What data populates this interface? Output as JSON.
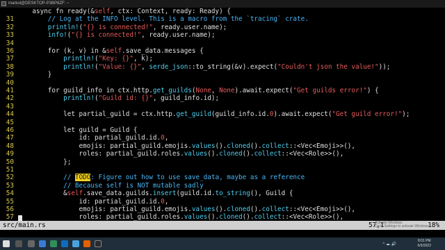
{
  "window": {
    "title": "markol@DESKTOP-P3BP8ZF: ~"
  },
  "code_lines": [
    {
      "n": "",
      "parts": [
        [
          "k",
          "    async fn ready(&"
        ],
        [
          "s",
          "self"
        ],
        [
          "k",
          ", ctx: Context, ready: Ready) {"
        ]
      ]
    },
    {
      "n": "31",
      "parts": [
        [
          "c",
          "        // Log at the INFO level. This is a macro from the `tracing` crate."
        ]
      ]
    },
    {
      "n": "32",
      "parts": [
        [
          "m",
          "        println!"
        ],
        [
          "k",
          "("
        ],
        [
          "s",
          "\"{} is connected!\""
        ],
        [
          "k",
          ", ready.user.name);"
        ]
      ]
    },
    {
      "n": "33",
      "parts": [
        [
          "m",
          "        info!"
        ],
        [
          "k",
          "("
        ],
        [
          "s",
          "\"{} is connected!\""
        ],
        [
          "k",
          ", ready.user.name);"
        ]
      ]
    },
    {
      "n": "34",
      "parts": []
    },
    {
      "n": "36",
      "parts": [
        [
          "k",
          "        for (k, v) in &"
        ],
        [
          "s",
          "self"
        ],
        [
          "k",
          ".save_data.messages {"
        ]
      ]
    },
    {
      "n": "37",
      "parts": [
        [
          "m",
          "            println!"
        ],
        [
          "k",
          "("
        ],
        [
          "s",
          "\"Key: {}\""
        ],
        [
          "k",
          ", k);"
        ]
      ]
    },
    {
      "n": "38",
      "parts": [
        [
          "m",
          "            println!"
        ],
        [
          "k",
          "("
        ],
        [
          "s",
          "\"Value: {}\""
        ],
        [
          "k",
          ", "
        ],
        [
          "m",
          "serde_json"
        ],
        [
          "k",
          "::to_string(&v).expect("
        ],
        [
          "s",
          "\"Couldn't json the value!\""
        ],
        [
          "k",
          "));"
        ]
      ]
    },
    {
      "n": "39",
      "parts": [
        [
          "k",
          "        }"
        ]
      ]
    },
    {
      "n": "40",
      "parts": []
    },
    {
      "n": "41",
      "parts": [
        [
          "k",
          "        for guild_info in ctx.http."
        ],
        [
          "m",
          "get_guilds"
        ],
        [
          "k",
          "("
        ],
        [
          "s",
          "None"
        ],
        [
          "k",
          ", "
        ],
        [
          "s",
          "None"
        ],
        [
          "k",
          ").await.expect("
        ],
        [
          "s",
          "\"Get guilds error!\""
        ],
        [
          "k",
          ") {"
        ]
      ]
    },
    {
      "n": "42",
      "parts": [
        [
          "m",
          "            println!"
        ],
        [
          "k",
          "("
        ],
        [
          "s",
          "\"Guild id: {}\""
        ],
        [
          "k",
          ", guild_info.id);"
        ]
      ]
    },
    {
      "n": "43",
      "parts": []
    },
    {
      "n": "44",
      "parts": [
        [
          "k",
          "            let partial_guild = ctx.http."
        ],
        [
          "m",
          "get_guild"
        ],
        [
          "k",
          "(guild_info.id."
        ],
        [
          "n",
          "0"
        ],
        [
          "k",
          ").await.expect("
        ],
        [
          "s",
          "\"Get guild error!\""
        ],
        [
          "k",
          ");"
        ]
      ]
    },
    {
      "n": "45",
      "parts": []
    },
    {
      "n": "46",
      "parts": [
        [
          "k",
          "            let guild = Guild {"
        ]
      ]
    },
    {
      "n": "47",
      "parts": [
        [
          "k",
          "                id: partial_guild.id."
        ],
        [
          "n",
          "0"
        ],
        [
          "k",
          ","
        ]
      ]
    },
    {
      "n": "48",
      "parts": [
        [
          "k",
          "                emojis: partial_guild.emojis."
        ],
        [
          "m",
          "values"
        ],
        [
          "k",
          "()."
        ],
        [
          "m",
          "cloned"
        ],
        [
          "k",
          "()."
        ],
        [
          "m",
          "collect"
        ],
        [
          "k",
          "::<Vec<Emoji>>(),"
        ]
      ]
    },
    {
      "n": "49",
      "parts": [
        [
          "k",
          "                roles: partial_guild.roles."
        ],
        [
          "m",
          "values"
        ],
        [
          "k",
          "()."
        ],
        [
          "m",
          "cloned"
        ],
        [
          "k",
          "()."
        ],
        [
          "m",
          "collect"
        ],
        [
          "k",
          "::<Vec<Role>>(),"
        ]
      ]
    },
    {
      "n": "50",
      "parts": [
        [
          "k",
          "            };"
        ]
      ]
    },
    {
      "n": "51",
      "parts": []
    },
    {
      "n": "52",
      "parts": [
        [
          "c",
          "            // "
        ],
        [
          "t",
          "TODO"
        ],
        [
          "c",
          ": Figure out how to use save_data, maybe as a reference"
        ]
      ]
    },
    {
      "n": "53",
      "parts": [
        [
          "c",
          "            // Because self is NOT mutable sadly"
        ]
      ]
    },
    {
      "n": "54",
      "parts": [
        [
          "k",
          "            &"
        ],
        [
          "s",
          "self"
        ],
        [
          "k",
          ".save_data.guilds."
        ],
        [
          "m",
          "insert"
        ],
        [
          "k",
          "(guild.id."
        ],
        [
          "m",
          "to_string"
        ],
        [
          "k",
          "(), Guild {"
        ]
      ]
    },
    {
      "n": "55",
      "parts": [
        [
          "k",
          "                id: partial_guild.id."
        ],
        [
          "n",
          "0"
        ],
        [
          "k",
          ","
        ]
      ]
    },
    {
      "n": "56",
      "parts": [
        [
          "k",
          "                emojis: partial_guild.emojis."
        ],
        [
          "m",
          "values"
        ],
        [
          "k",
          "()."
        ],
        [
          "m",
          "cloned"
        ],
        [
          "k",
          "()."
        ],
        [
          "m",
          "collect"
        ],
        [
          "k",
          "::<Vec<Emoji>>(),"
        ]
      ]
    },
    {
      "n": "57",
      "parts": [
        [
          "k",
          "                roles: partial_guild.roles."
        ],
        [
          "m",
          "values"
        ],
        [
          "k",
          "()."
        ],
        [
          "m",
          "cloned"
        ],
        [
          "k",
          "()."
        ],
        [
          "m",
          "collect"
        ],
        [
          "k",
          "::<Vec<Role>>(),"
        ]
      ]
    }
  ],
  "status": {
    "file": "src/main.rs",
    "position": "57,1",
    "percent": "18%"
  },
  "watermark": {
    "line1": "Activate Windows",
    "line2": "Go to Settings to activate Windows."
  },
  "tray": {
    "time": "8:01 PM",
    "date": "6/5/2022"
  },
  "colors": {
    "status_bg": "#d0d0d0",
    "line_number": "#d8c84a",
    "comment": "#49b5f5",
    "string": "#e85c5c",
    "method": "#4fd0ef",
    "taskbar": "#1f2e3a"
  }
}
